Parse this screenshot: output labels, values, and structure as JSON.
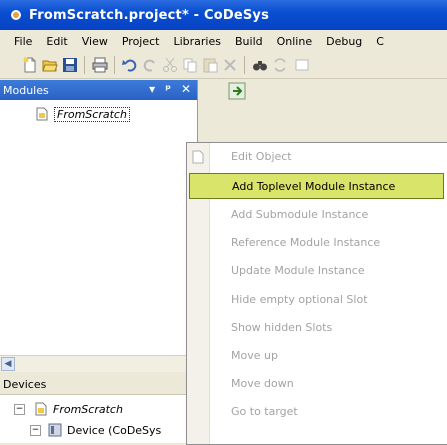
{
  "window": {
    "title": "FromScratch.project* - CoDeSys"
  },
  "menu": [
    {
      "label": "File"
    },
    {
      "label": "Edit"
    },
    {
      "label": "View"
    },
    {
      "label": "Project"
    },
    {
      "label": "Libraries"
    },
    {
      "label": "Build"
    },
    {
      "label": "Online"
    },
    {
      "label": "Debug"
    },
    {
      "label": "C"
    }
  ],
  "modules_panel": {
    "title": "Modules",
    "buttons": [
      "▾",
      "ᵖ",
      "✕"
    ],
    "tree": [
      {
        "label": "FromScratch"
      }
    ]
  },
  "devices_panel": {
    "title": "Devices",
    "tree": [
      {
        "label": "FromScratch"
      },
      {
        "label": "Device (CoDeSys"
      }
    ]
  },
  "context_menu": {
    "items": [
      {
        "label": "Edit Object",
        "enabled": false
      },
      {
        "label": "Add Toplevel Module Instance",
        "enabled": true,
        "highlighted": true
      },
      {
        "label": "Add Submodule Instance",
        "enabled": false
      },
      {
        "label": "Reference Module Instance",
        "enabled": false
      },
      {
        "label": "Update Module Instance",
        "enabled": false
      },
      {
        "label": "Hide empty optional Slot",
        "enabled": false
      },
      {
        "label": "Show hidden Slots",
        "enabled": false
      },
      {
        "label": "Move up",
        "enabled": false
      },
      {
        "label": "Move down",
        "enabled": false
      },
      {
        "label": "Go to target",
        "enabled": false
      }
    ]
  },
  "colors": {
    "title_bar": "#0a4fd0",
    "highlight": "#d8e56a",
    "disabled_text": "#a3a3a3"
  }
}
